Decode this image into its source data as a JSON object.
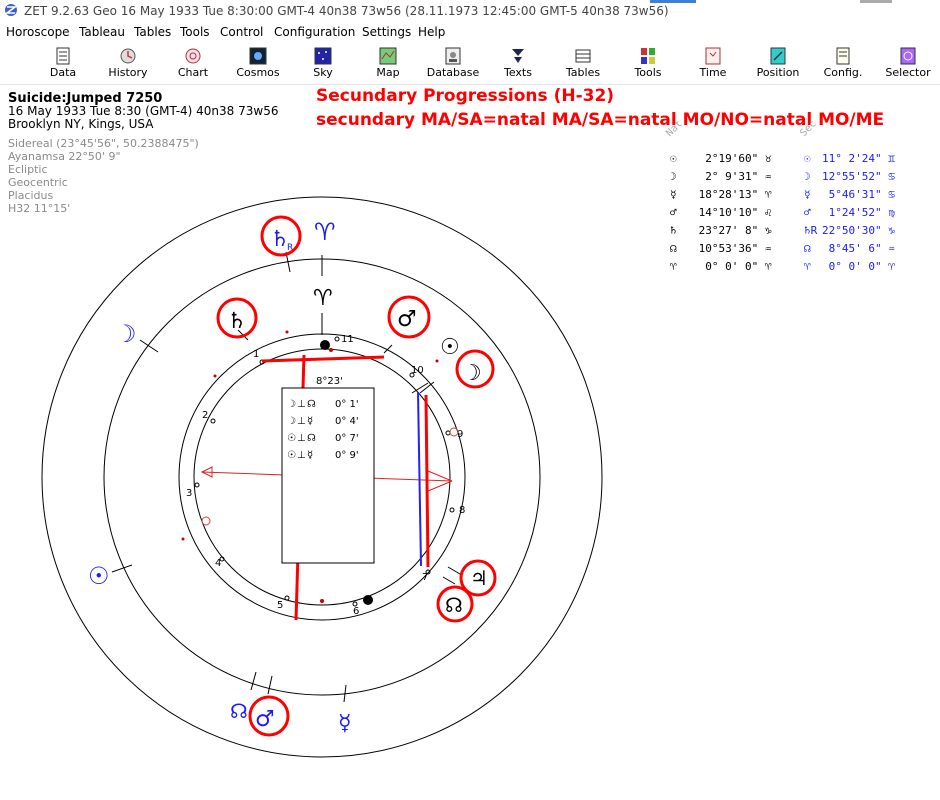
{
  "window": {
    "title": "ZET 9.2.63 Geo   16 May 1933  Tue   8:30:00 GMT-4 40n38  73w56  (28.11.1973  12:45:00 GMT-5 40n38 73w56)"
  },
  "menu": [
    "Horoscope",
    "Tableau",
    "Tables",
    "Tools",
    "Control",
    "Configuration",
    "Settings",
    "Help"
  ],
  "toolbar": [
    {
      "label": "Data",
      "icon": "data-icon"
    },
    {
      "label": "History",
      "icon": "history-icon"
    },
    {
      "label": "Chart",
      "icon": "chart-icon"
    },
    {
      "label": "Cosmos",
      "icon": "cosmos-icon"
    },
    {
      "label": "Sky",
      "icon": "sky-icon"
    },
    {
      "label": "Map",
      "icon": "map-icon"
    },
    {
      "label": "Database",
      "icon": "database-icon"
    },
    {
      "label": "Texts",
      "icon": "texts-icon"
    },
    {
      "label": "Tables",
      "icon": "tables-icon"
    },
    {
      "label": "Tools",
      "icon": "tools-icon"
    },
    {
      "label": "Time",
      "icon": "time-icon"
    },
    {
      "label": "Position",
      "icon": "position-icon"
    },
    {
      "label": "Config.",
      "icon": "config-icon"
    },
    {
      "label": "Selector",
      "icon": "selector-icon"
    }
  ],
  "chart_info": {
    "name": "Suicide:Jumped 7250",
    "date_line": "16 May 1933  Tue   8:30 (GMT-4)  40n38   73w56",
    "place": "Brooklyn NY, Kings, USA",
    "settings": [
      "Sidereal (23°45'56\", 50.2388475\")",
      "Ayanamsa 22°50' 9\"",
      "Ecliptic",
      "Geocentric",
      "Placidus",
      "H32  11°15'"
    ]
  },
  "heading": {
    "line1": "Secundary Progressions (H-32)",
    "line2": "secundary MA/SA=natal MA/SA=natal MO/NO=natal MO/ME"
  },
  "wheel": {
    "center_box_title": "8°23'",
    "aspect_rows": [
      {
        "a": "☽",
        "op": "⊥",
        "b": "☊",
        "orb": "0° 1'"
      },
      {
        "a": "☽",
        "op": "⊥",
        "b": "☿",
        "orb": "0° 4'"
      },
      {
        "a": "☉",
        "op": "⊥",
        "b": "☊",
        "orb": "0° 7'"
      },
      {
        "a": "☉",
        "op": "⊥",
        "b": "☿",
        "orb": "0° 9'"
      }
    ],
    "house_numbers": [
      "1",
      "2",
      "3",
      "4",
      "5",
      "6",
      "7",
      "8",
      "9",
      "10",
      "11"
    ],
    "natal_glyphs": [
      "♄",
      "♂",
      "☉",
      "☽",
      "♃",
      "☊",
      "♈"
    ],
    "progressed_glyphs": [
      "♄",
      "♈",
      "☽",
      "☉",
      "☊",
      "♂",
      "☿"
    ],
    "retrograde_mark": "R"
  },
  "positions": {
    "natal_header": "Nat",
    "secondary_header": "Sec",
    "rows": [
      {
        "n_sym": "☉",
        "n_val": "  2°19'60\" ♉",
        "s_sym": "☉",
        "s_val": "11° 2'24\" ♊"
      },
      {
        "n_sym": "☽",
        "n_val": "  2° 9'31\" ♒",
        "s_sym": "☽",
        "s_val": "12°55'52\" ♋"
      },
      {
        "n_sym": "☿",
        "n_val": " 18°28'13\" ♈",
        "s_sym": "☿",
        "s_val": " 5°46'31\" ♋"
      },
      {
        "n_sym": "♂",
        "n_val": " 14°10'10\" ♌",
        "s_sym": "♂",
        "s_val": " 1°24'52\" ♍"
      },
      {
        "n_sym": "♄",
        "n_val": " 23°27' 8\" ♑",
        "s_sym": "♄R",
        "s_val": "22°50'30\" ♑"
      },
      {
        "n_sym": "☊",
        "n_val": " 10°53'36\" ♒",
        "s_sym": "☊",
        "s_val": " 8°45' 6\" ♒"
      },
      {
        "n_sym": "♈",
        "n_val": "  0° 0' 0\" ♈",
        "s_sym": "♈",
        "s_val": " 0° 0' 0\" ♈"
      }
    ]
  },
  "colors": {
    "highlight_red": "#ff0000",
    "progressed_blue": "#1a1aff",
    "natal_black": "#000000"
  }
}
